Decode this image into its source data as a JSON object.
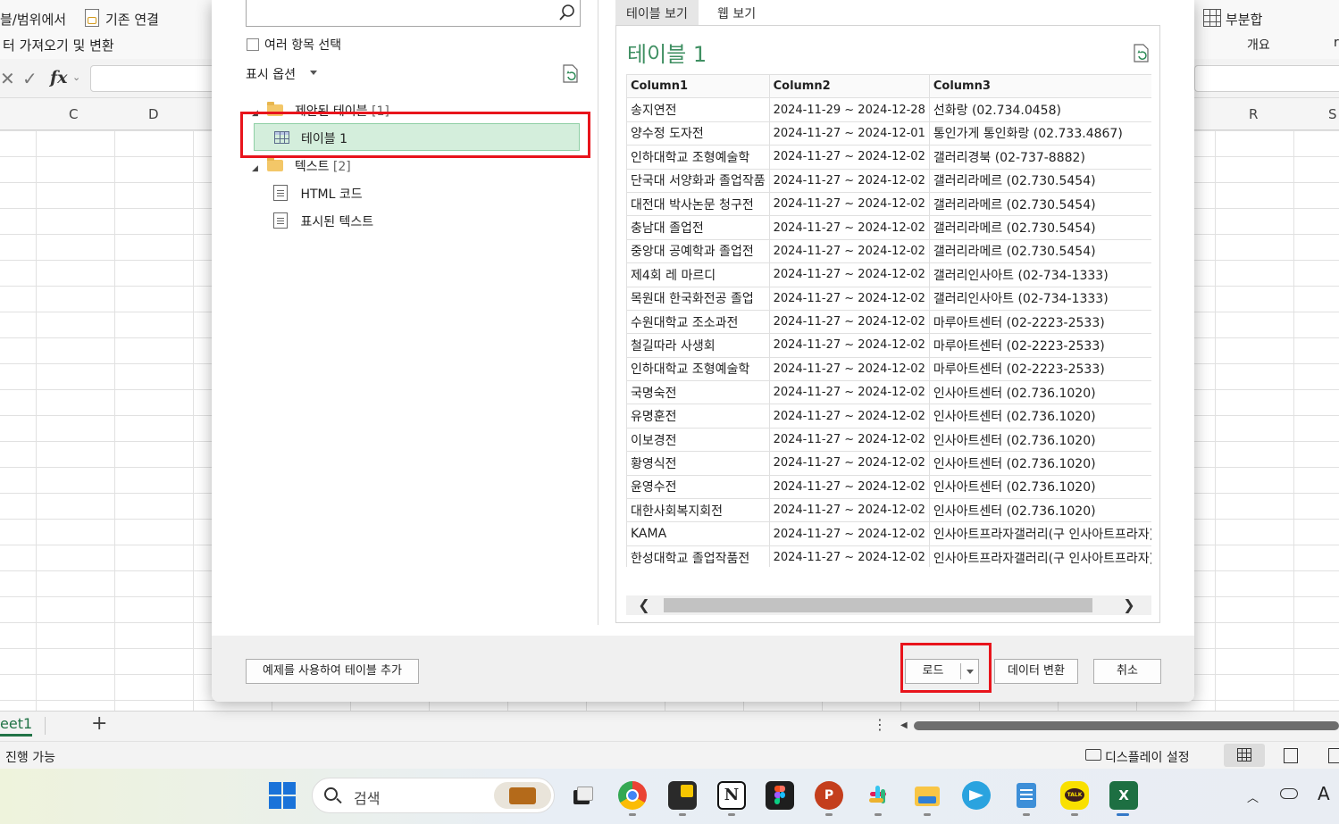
{
  "ribbon": {
    "from_table": "블/범위에서",
    "existing_connections": "기존 연결",
    "get_transform": "터 가져오기 및 변환",
    "subtotal": "부분합",
    "outline": "개요",
    "outline_r": "r"
  },
  "formula_bar": {
    "fx": "fx"
  },
  "columns": {
    "c": "C",
    "d": "D",
    "r": "R",
    "s": "S"
  },
  "sheet_tabs": {
    "sheet": "eet1",
    "add": "+",
    "more": "⋮"
  },
  "status": {
    "ready": "진행 가능",
    "display_settings": "디스플레이 설정"
  },
  "taskbar": {
    "search": "검색",
    "ime": "A"
  },
  "navigator": {
    "select_multiple": "여러 항목 선택",
    "display_options": "표시 옵션",
    "tree": {
      "suggested_folder": "제안된 테이블",
      "suggested_count": "[1]",
      "table1": "테이블 1",
      "text_folder": "텍스트",
      "text_count": "[2]",
      "html_code": "HTML 코드",
      "displayed_text": "표시된 텍스트"
    }
  },
  "preview": {
    "tab_table": "테이블 보기",
    "tab_web": "웹 보기",
    "title": "테이블 1",
    "headers": [
      "Column1",
      "Column2",
      "Column3"
    ],
    "rows": [
      [
        "송지연전",
        "2024-11-29 ~ 2024-12-28",
        "선화랑 (02.734.0458)"
      ],
      [
        "양수정 도자전",
        "2024-11-27 ~ 2024-12-01",
        "통인가게 통인화랑 (02.733.4867)"
      ],
      [
        "인하대학교 조형예술학",
        "2024-11-27 ~ 2024-12-02",
        "갤러리경북 (02-737-8882)"
      ],
      [
        "단국대 서양화과 졸업작품",
        "2024-11-27 ~ 2024-12-02",
        "갤러리라메르 (02.730.5454)"
      ],
      [
        "대전대 박사논문 청구전",
        "2024-11-27 ~ 2024-12-02",
        "갤러리라메르 (02.730.5454)"
      ],
      [
        "충남대 졸업전",
        "2024-11-27 ~ 2024-12-02",
        "갤러리라메르 (02.730.5454)"
      ],
      [
        "중앙대 공예학과 졸업전",
        "2024-11-27 ~ 2024-12-02",
        "갤러리라메르 (02.730.5454)"
      ],
      [
        "제4회 레 마르디",
        "2024-11-27 ~ 2024-12-02",
        "갤러리인사아트 (02-734-1333)"
      ],
      [
        "목원대 한국화전공 졸업",
        "2024-11-27 ~ 2024-12-02",
        "갤러리인사아트 (02-734-1333)"
      ],
      [
        "수원대학교 조소과전",
        "2024-11-27 ~ 2024-12-02",
        "마루아트센터 (02-2223-2533)"
      ],
      [
        "철길따라 사생회",
        "2024-11-27 ~ 2024-12-02",
        "마루아트센터 (02-2223-2533)"
      ],
      [
        "인하대학교 조형예술학",
        "2024-11-27 ~ 2024-12-02",
        "마루아트센터 (02-2223-2533)"
      ],
      [
        "국명숙전",
        "2024-11-27 ~ 2024-12-02",
        "인사아트센터 (02.736.1020)"
      ],
      [
        "유명훈전",
        "2024-11-27 ~ 2024-12-02",
        "인사아트센터 (02.736.1020)"
      ],
      [
        "이보경전",
        "2024-11-27 ~ 2024-12-02",
        "인사아트센터 (02.736.1020)"
      ],
      [
        "황영식전",
        "2024-11-27 ~ 2024-12-02",
        "인사아트센터 (02.736.1020)"
      ],
      [
        "윤영수전",
        "2024-11-27 ~ 2024-12-02",
        "인사아트센터 (02.736.1020)"
      ],
      [
        "대한사회복지회전",
        "2024-11-27 ~ 2024-12-02",
        "인사아트센터 (02.736.1020)"
      ],
      [
        "KAMA",
        "2024-11-27 ~ 2024-12-02",
        "인사아트프라자갤러리(구 인사아트프라자)"
      ],
      [
        "한성대학교 졸업작품전",
        "2024-11-27 ~ 2024-12-02",
        "인사아트프라자갤러리(구 인사아트프라자)"
      ]
    ]
  },
  "footer": {
    "add_table_by_example": "예제를 사용하여 테이블 추가",
    "load": "로드",
    "transform_data": "데이터 변환",
    "cancel": "취소"
  },
  "colors": {
    "accent_green": "#3f8f62",
    "highlight_red": "#e8141c",
    "selected_bg": "#d4eedc"
  }
}
